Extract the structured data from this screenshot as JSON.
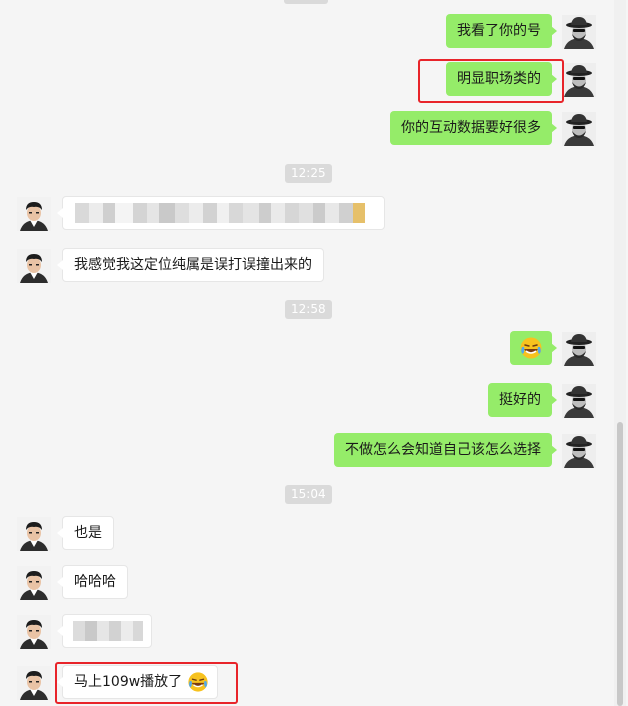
{
  "conversation": {
    "times": {
      "t1": "12:25",
      "t2": "12:58",
      "t3": "15:04"
    },
    "messages": {
      "m1": "我看了你的号",
      "m2": "明显职场类的",
      "m3": "你的互动数据要好很多",
      "m5": "我感觉我这定位纯属是误打误撞出来的",
      "m7": "挺好的",
      "m8": "不做怎么会知道自己该怎么选择",
      "m9": "也是",
      "m10": "哈哈哈",
      "m12": "马上109w播放了"
    },
    "emoji_name": "rofl-laughing-emoji"
  },
  "colors": {
    "self_bubble": "#95ec69",
    "other_bubble": "#ffffff",
    "highlight": "#e8242a",
    "background": "#f5f5f5"
  }
}
